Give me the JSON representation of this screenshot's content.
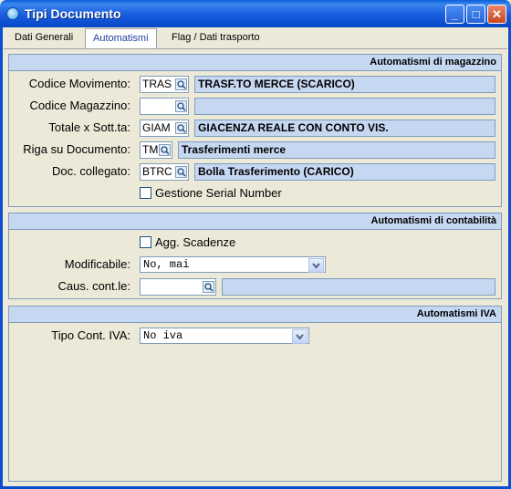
{
  "window": {
    "title": "Tipi Documento"
  },
  "tabs": [
    "Dati Generali",
    "Automatismi",
    "Flag / Dati trasporto"
  ],
  "magazzino": {
    "header": "Automatismi di magazzino",
    "rows": [
      {
        "label": "Codice Movimento:",
        "code": "TRAS",
        "desc": "TRASF.TO MERCE (SCARICO)"
      },
      {
        "label": "Codice Magazzino:",
        "code": "",
        "desc": ""
      },
      {
        "label": "Totale x Sott.ta:",
        "code": "GIAM",
        "desc": "GIACENZA REALE CON CONTO VIS."
      },
      {
        "label": "Riga su Documento:",
        "code": "TM",
        "desc": "Trasferimenti merce"
      },
      {
        "label": "Doc. collegato:",
        "code": "BTRC",
        "desc": "Bolla Trasferimento (CARICO)"
      }
    ],
    "serial_label": "Gestione Serial Number"
  },
  "contabilita": {
    "header": "Automatismi di contabilità",
    "scadenze_label": "Agg. Scadenze",
    "modificabile_label": "Modificabile:",
    "modificabile_value": "No, mai",
    "causale_label": "Caus. cont.le:",
    "causale_code": "",
    "causale_desc": ""
  },
  "iva": {
    "header": "Automatismi IVA",
    "tipo_label": "Tipo Cont. IVA:",
    "tipo_value": "No iva"
  },
  "colors": {
    "accent": "#0b4fd0",
    "panel_header": "#c6d7f2"
  }
}
